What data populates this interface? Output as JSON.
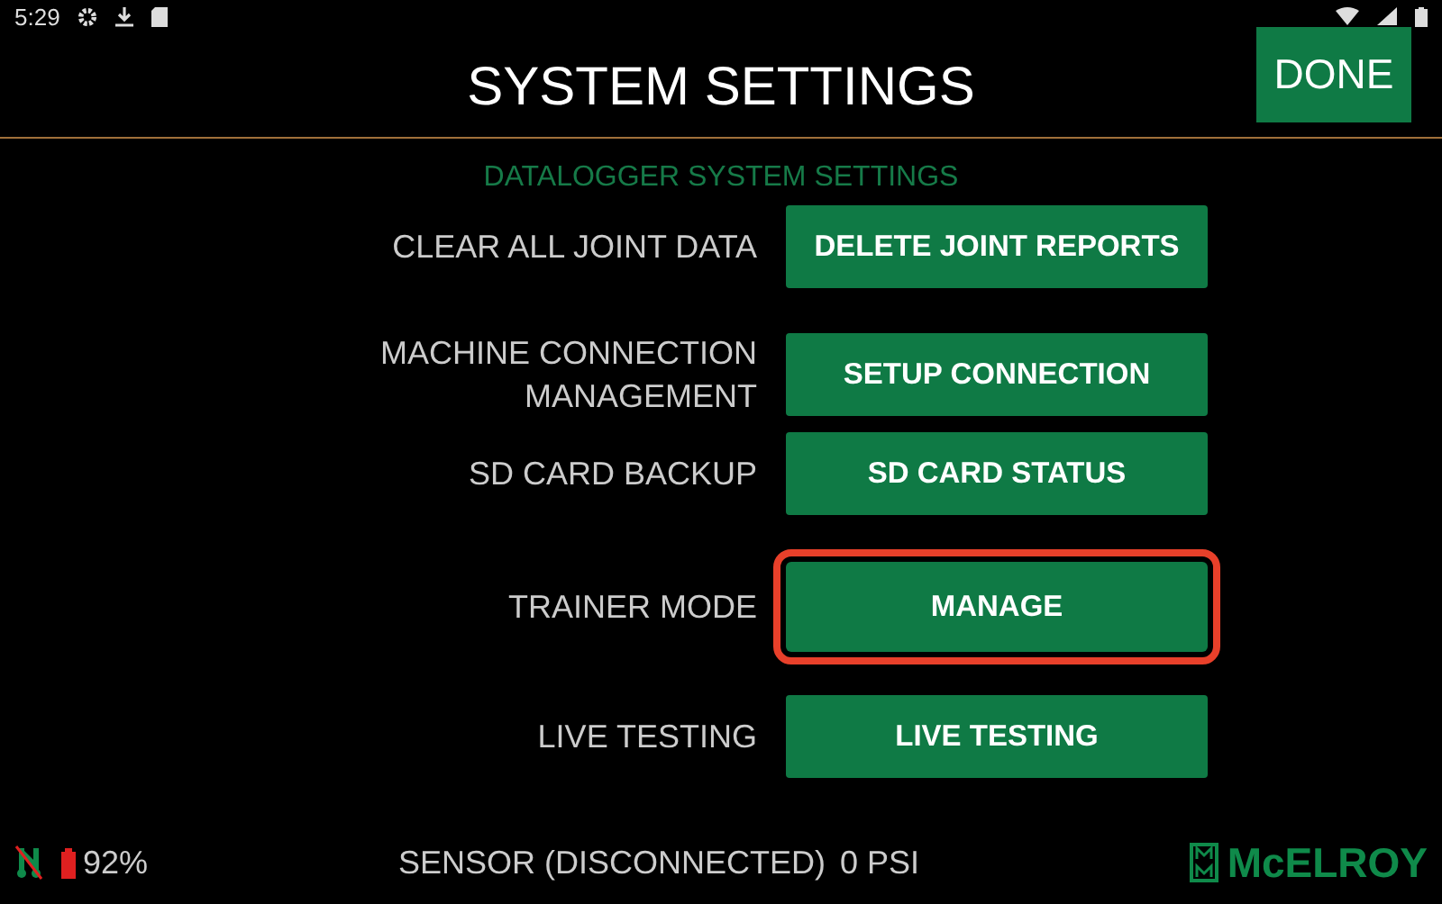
{
  "status_bar": {
    "time": "5:29"
  },
  "header": {
    "title": "SYSTEM SETTINGS",
    "done_button": "DONE"
  },
  "section": {
    "title": "DATALOGGER SYSTEM SETTINGS"
  },
  "settings": [
    {
      "label": "CLEAR ALL JOINT DATA",
      "button": "DELETE JOINT REPORTS",
      "highlighted": false
    },
    {
      "label": "MACHINE CONNECTION MANAGEMENT",
      "button": "SETUP CONNECTION",
      "highlighted": false
    },
    {
      "label": "SD CARD BACKUP",
      "button": "SD CARD STATUS",
      "highlighted": false
    },
    {
      "label": "TRAINER MODE",
      "button": "MANAGE",
      "highlighted": true
    },
    {
      "label": "LIVE TESTING",
      "button": "LIVE TESTING",
      "highlighted": false
    }
  ],
  "footer": {
    "battery": "92%",
    "sensor": "SENSOR (DISCONNECTED)",
    "pressure": "0 PSI",
    "logo": "McELROY"
  }
}
